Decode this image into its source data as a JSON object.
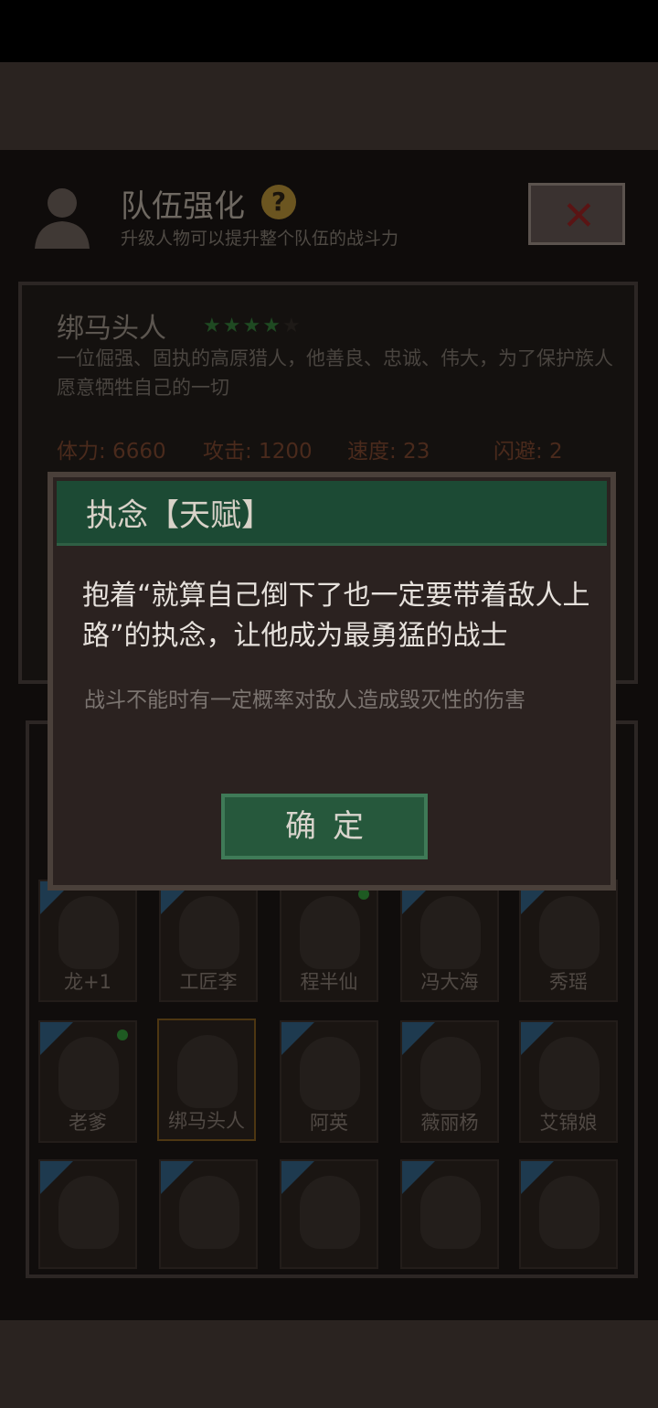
{
  "header": {
    "title": "队伍强化",
    "help_icon": "question-mark-icon",
    "subtitle": "升级人物可以提升整个队伍的战斗力",
    "close_icon": "close-x-icon"
  },
  "character": {
    "name": "绑马头人",
    "stars_filled": 4,
    "stars_total": 5,
    "description": "一位倔强、固执的高原猎人，他善良、忠诚、伟大，为了保护族人愿意牺牲自己的一切",
    "stats": [
      {
        "label": "体力: 6660"
      },
      {
        "label": "攻击: 1200"
      },
      {
        "label": "速度: 23"
      },
      {
        "label": "闪避: 2"
      }
    ]
  },
  "roster": {
    "rows": [
      [
        {
          "name": "龙+1"
        },
        {
          "name": "工匠李"
        },
        {
          "name": "程半仙"
        },
        {
          "name": "冯大海"
        },
        {
          "name": "秀瑶"
        }
      ],
      [
        {
          "name": "老爹"
        },
        {
          "name": "绑马头人"
        },
        {
          "name": "阿英"
        },
        {
          "name": "薇丽杨"
        },
        {
          "name": "艾锦娘"
        }
      ]
    ]
  },
  "dialog": {
    "title": "执念【天赋】",
    "main_text": "抱着“就算自己倒下了也一定要带着敌人上路”的执念，让他成为最勇猛的战士",
    "sub_text": "战斗不能时有一定概率对敌人造成毁灭性的伤害",
    "confirm_label": "确定"
  },
  "colors": {
    "dialog_header": "#1c4a34",
    "confirm_button": "#26583c",
    "star": "#1f4a22"
  }
}
